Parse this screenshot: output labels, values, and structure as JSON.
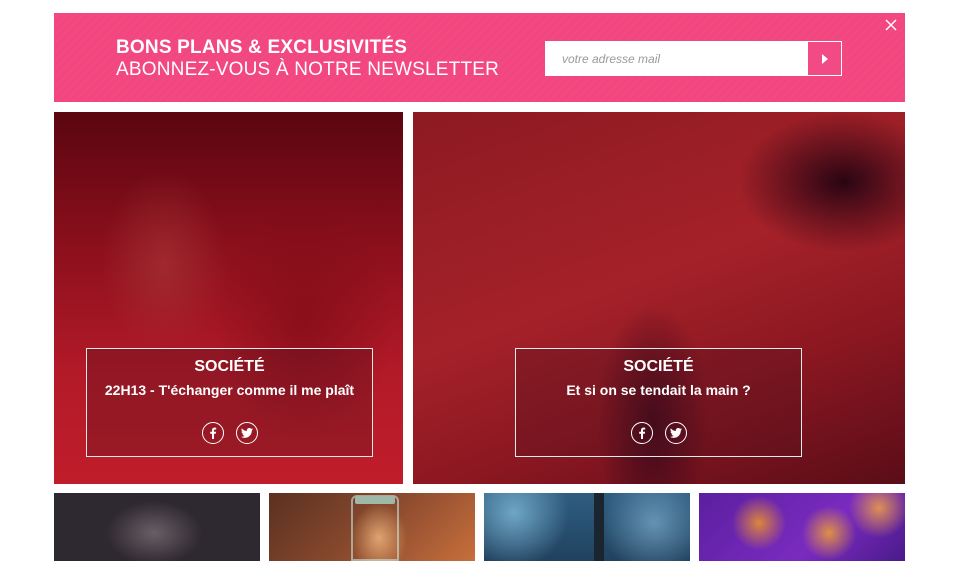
{
  "newsletter": {
    "title": "BONS PLANS & EXCLUSIVITÉS",
    "subtitle": "ABONNEZ-VOUS À NOTRE NEWSLETTER",
    "email_placeholder": "votre adresse mail",
    "submit_icon": "play-arrow-icon",
    "close_icon": "close-icon",
    "background_color": "#f5457f"
  },
  "cards": [
    {
      "category": "SOCIÉTÉ",
      "title": "22H13 - T'échanger comme il me plaît",
      "share": [
        "facebook-icon",
        "twitter-icon"
      ]
    },
    {
      "category": "SOCIÉTÉ",
      "title": "Et si on se tendait la main ?",
      "share": [
        "facebook-icon",
        "twitter-icon"
      ]
    }
  ],
  "thumbnails": [
    "thumbnail-face",
    "thumbnail-jar-lights",
    "thumbnail-blue-bokeh",
    "thumbnail-purple-flowers"
  ]
}
